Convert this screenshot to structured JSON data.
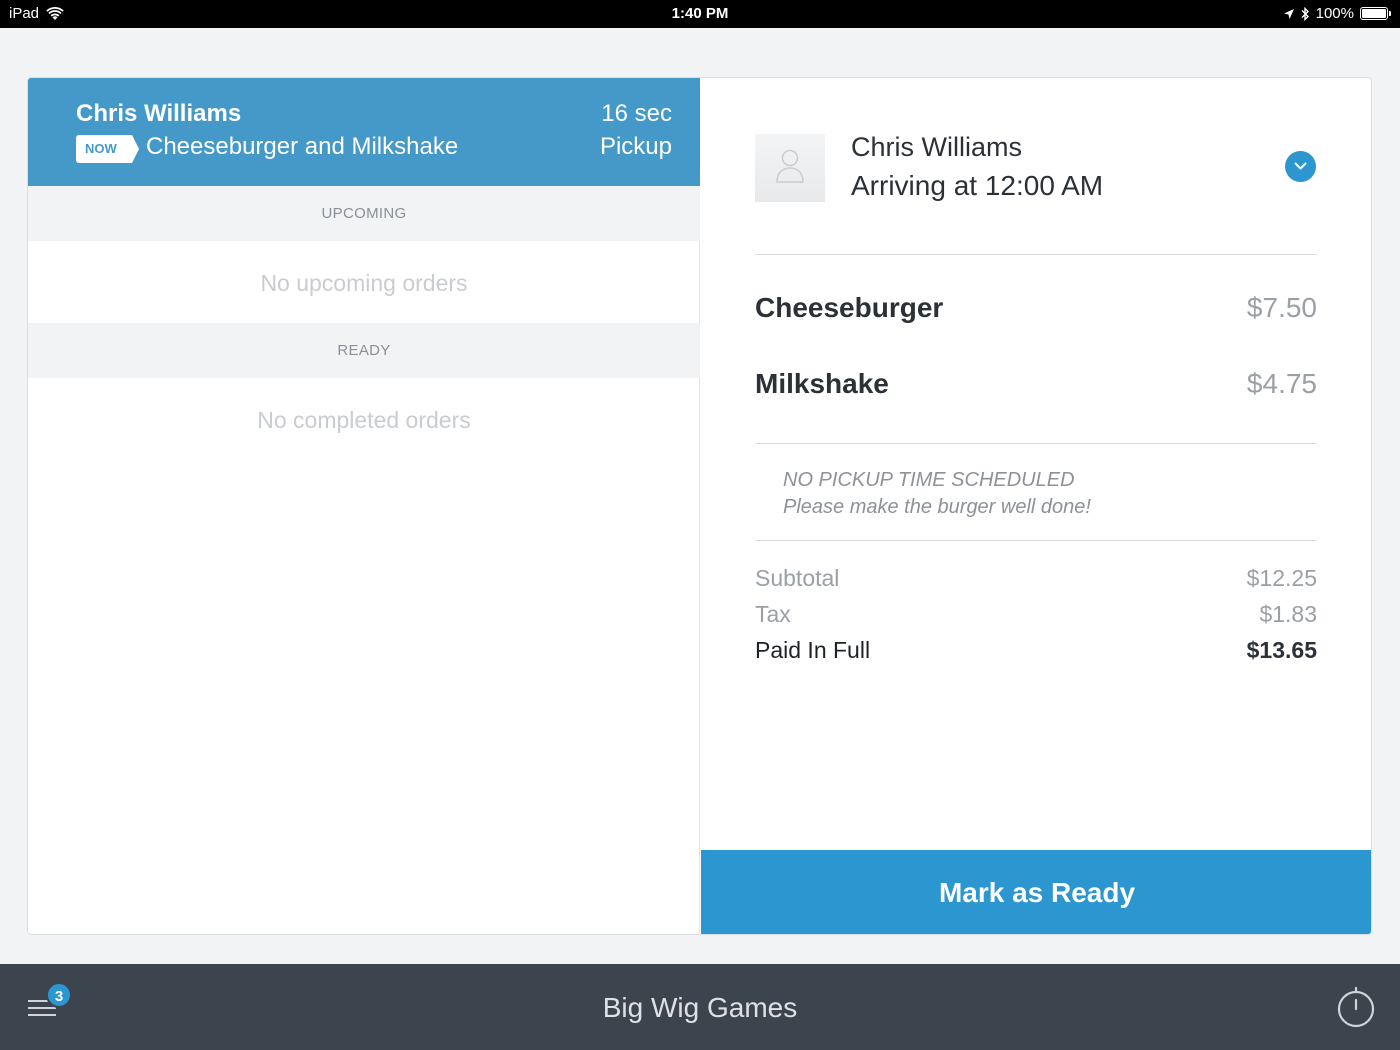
{
  "status_bar": {
    "device": "iPad",
    "time": "1:40 PM",
    "battery": "100%"
  },
  "active_order": {
    "customer": "Chris Williams",
    "badge": "NOW",
    "items": "Cheeseburger and Milkshake",
    "elapsed": "16 sec",
    "fulfillment": "Pickup"
  },
  "sections": {
    "upcoming": {
      "header": "UPCOMING",
      "empty": "No upcoming orders"
    },
    "ready": {
      "header": "READY",
      "empty": "No completed orders"
    }
  },
  "detail": {
    "customer": "Chris Williams",
    "arrival": "Arriving at 12:00 AM",
    "line_items": [
      {
        "name": "Cheeseburger",
        "price": "$7.50"
      },
      {
        "name": "Milkshake",
        "price": "$4.75"
      }
    ],
    "note_title": "NO PICKUP TIME SCHEDULED",
    "note_body": "Please make the burger well done!",
    "totals": {
      "subtotal_label": "Subtotal",
      "subtotal": "$12.25",
      "tax_label": "Tax",
      "tax": "$1.83",
      "paid_label": "Paid In Full",
      "paid": "$13.65"
    },
    "action_label": "Mark as Ready"
  },
  "bottom_bar": {
    "venue": "Big Wig Games",
    "orders_badge": "3"
  },
  "colors": {
    "accent": "#2b96d0",
    "active_order_bg": "#4599c8",
    "bottom_bar": "#3c444d"
  },
  "icons": [
    "wifi-icon",
    "location-icon",
    "bluetooth-icon",
    "battery-icon",
    "avatar-placeholder-icon",
    "chevron-down-icon",
    "menu-icon",
    "timer-icon"
  ]
}
